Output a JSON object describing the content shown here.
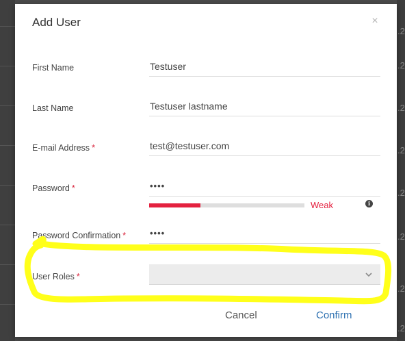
{
  "dialog": {
    "title": "Add User",
    "close_symbol": "×",
    "required_marker": "*"
  },
  "fields": {
    "first_name": {
      "label": "First Name",
      "value": "Testuser"
    },
    "last_name": {
      "label": "Last Name",
      "value": "Testuser lastname"
    },
    "email": {
      "label": "E-mail Address",
      "value": "test@testuser.com"
    },
    "password": {
      "label": "Password",
      "value": "••••"
    },
    "password_confirmation": {
      "label": "Password Confirmation",
      "value": "••••"
    },
    "user_roles": {
      "label": "User Roles",
      "value": ""
    }
  },
  "password_strength": {
    "label": "Weak",
    "level": 0.33,
    "color": "#e4213f",
    "info_symbol": "i"
  },
  "buttons": {
    "cancel": "Cancel",
    "confirm": "Confirm"
  },
  "background_fragments": [
    ".2",
    ".2",
    ".2",
    ".2",
    ".2",
    ".2",
    ".2",
    ".2"
  ],
  "colors": {
    "accent": "#2b6fb0",
    "required": "#d9263e",
    "highlight": "#ffff1a"
  },
  "icons": [
    "close-icon",
    "info-icon",
    "chevron-down-icon"
  ]
}
